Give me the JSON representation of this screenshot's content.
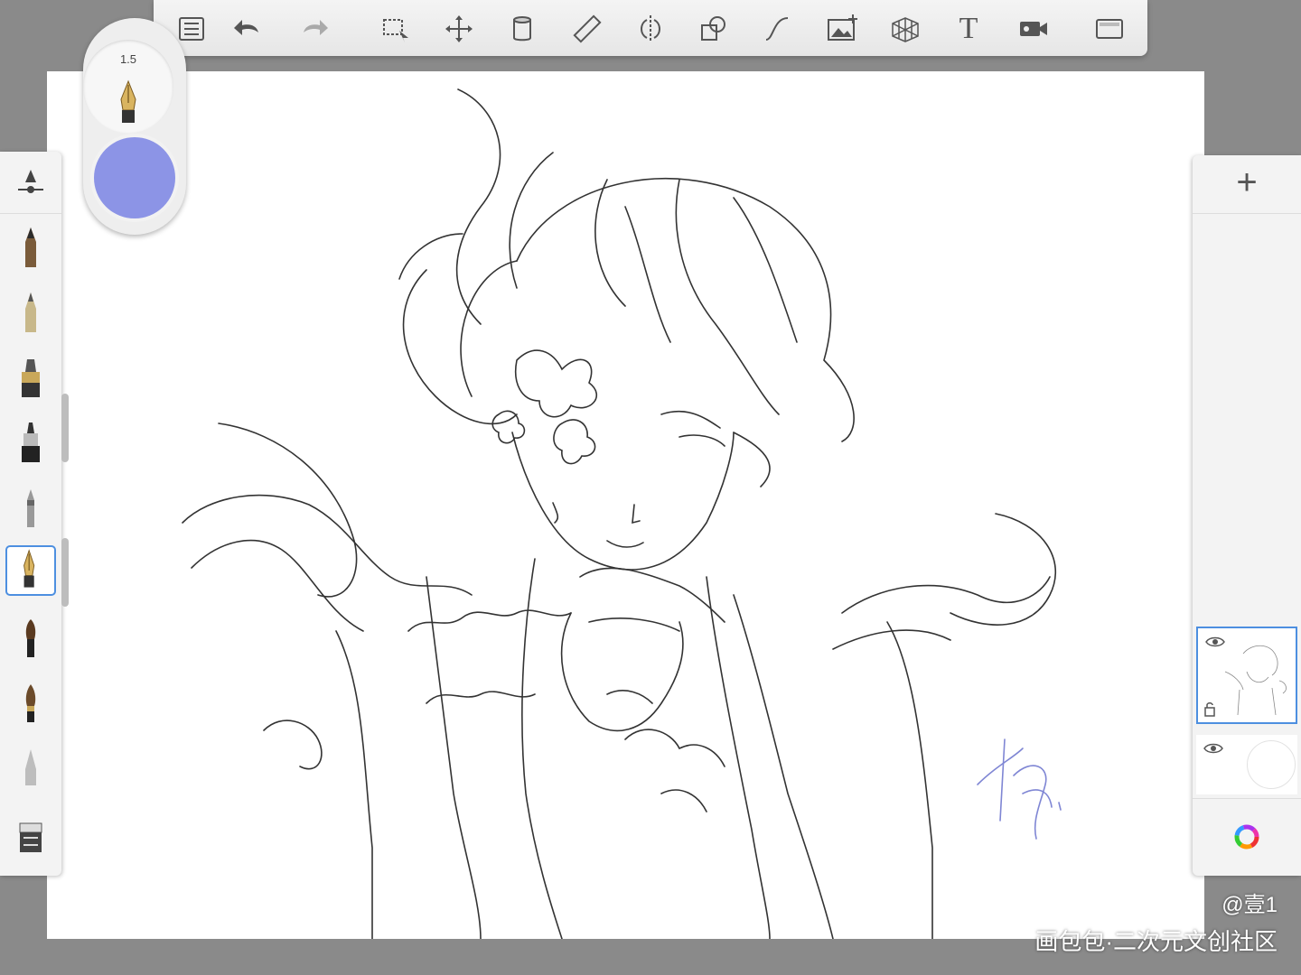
{
  "brush": {
    "size_label": "1.5",
    "color": "#8c94e6"
  },
  "toolbar": {
    "tools": [
      "brush-library-icon",
      "undo-icon",
      "redo-icon",
      "selection-icon",
      "transform-icon",
      "fill-icon",
      "ruler-icon",
      "symmetry-icon",
      "shapes-icon",
      "curve-icon",
      "import-image-icon",
      "perspective-icon",
      "text-icon",
      "time-lapse-icon",
      "fullscreen-icon"
    ],
    "text_tool_label": "T"
  },
  "brush_panel": {
    "active_index": 5,
    "brushes": [
      "pencil-brush-icon",
      "hard-pencil-brush-icon",
      "marker-brush-icon",
      "ink-pen-brush-icon",
      "airbrush-brush-icon",
      "fountain-pen-brush-icon",
      "paint-brush-icon",
      "soft-brush-icon",
      "smudge-brush-icon",
      "eraser-brush-icon"
    ]
  },
  "layers": {
    "add_label": "+",
    "items": [
      {
        "name": "sketch-layer",
        "visible": true,
        "active": true
      },
      {
        "name": "blank-layer",
        "visible": true,
        "active": false
      }
    ]
  },
  "watermark": {
    "user": "@壹1",
    "site": "画包包·二次元文创社区"
  },
  "accent_color": "#4d8fe0"
}
